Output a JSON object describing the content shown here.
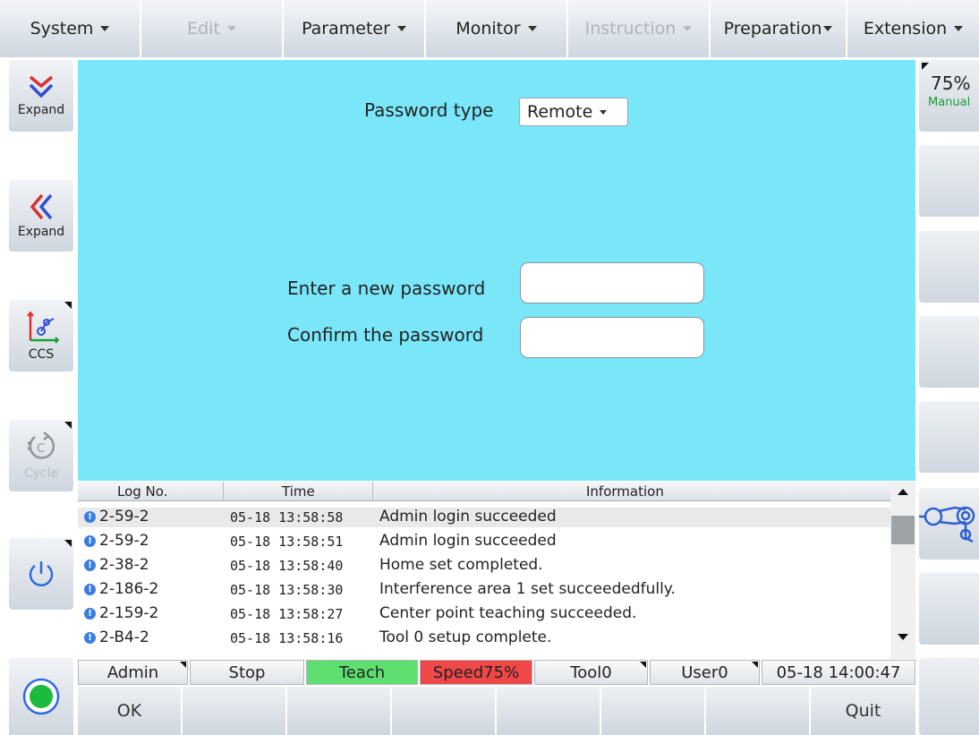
{
  "menubar": {
    "items": [
      {
        "label": "System",
        "disabled": false
      },
      {
        "label": "Edit",
        "disabled": true
      },
      {
        "label": "Parameter",
        "disabled": false
      },
      {
        "label": "Monitor",
        "disabled": false
      },
      {
        "label": "Instruction",
        "disabled": true
      },
      {
        "label": "Preparation",
        "disabled": false
      },
      {
        "label": "Extension",
        "disabled": false
      }
    ]
  },
  "left_toolbar": {
    "expand1_label": "Expand",
    "expand2_label": "Expand",
    "ccs_label": "CCS",
    "cycle_label": "Cycle"
  },
  "right_toolbar": {
    "speed_value": "75%",
    "mode_label": "Manual"
  },
  "form": {
    "password_type_label": "Password type",
    "password_type_value": "Remote",
    "new_password_label": "Enter a new password",
    "confirm_password_label": "Confirm the password",
    "new_password_value": "",
    "confirm_password_value": ""
  },
  "log": {
    "headers": [
      "Log No.",
      "Time",
      "Information"
    ],
    "rows": [
      {
        "no": "2-59-2",
        "time": "05-18 13:58:58",
        "info": "Admin  login succeeded"
      },
      {
        "no": "2-59-2",
        "time": "05-18 13:58:51",
        "info": "Admin  login succeeded"
      },
      {
        "no": "2-38-2",
        "time": "05-18 13:58:40",
        "info": "Home set completed."
      },
      {
        "no": "2-186-2",
        "time": "05-18 13:58:30",
        "info": "Interference area 1 set succeededfully."
      },
      {
        "no": "2-159-2",
        "time": "05-18 13:58:27",
        "info": "Center point teaching succeeded."
      },
      {
        "no": "2-B4-2",
        "time": "05-18 13:58:16",
        "info": "Tool 0 setup complete."
      }
    ]
  },
  "status": {
    "user": "Admin",
    "run_state": "Stop",
    "mode": "Teach",
    "speed": "Speed75%",
    "tool": "Tool0",
    "user_frame": "User0",
    "datetime": "05-18 14:00:47",
    "colors": {
      "teach": "#5de070",
      "speed": "#f04848"
    }
  },
  "fkeys": {
    "ok_label": "OK",
    "quit_label": "Quit"
  }
}
